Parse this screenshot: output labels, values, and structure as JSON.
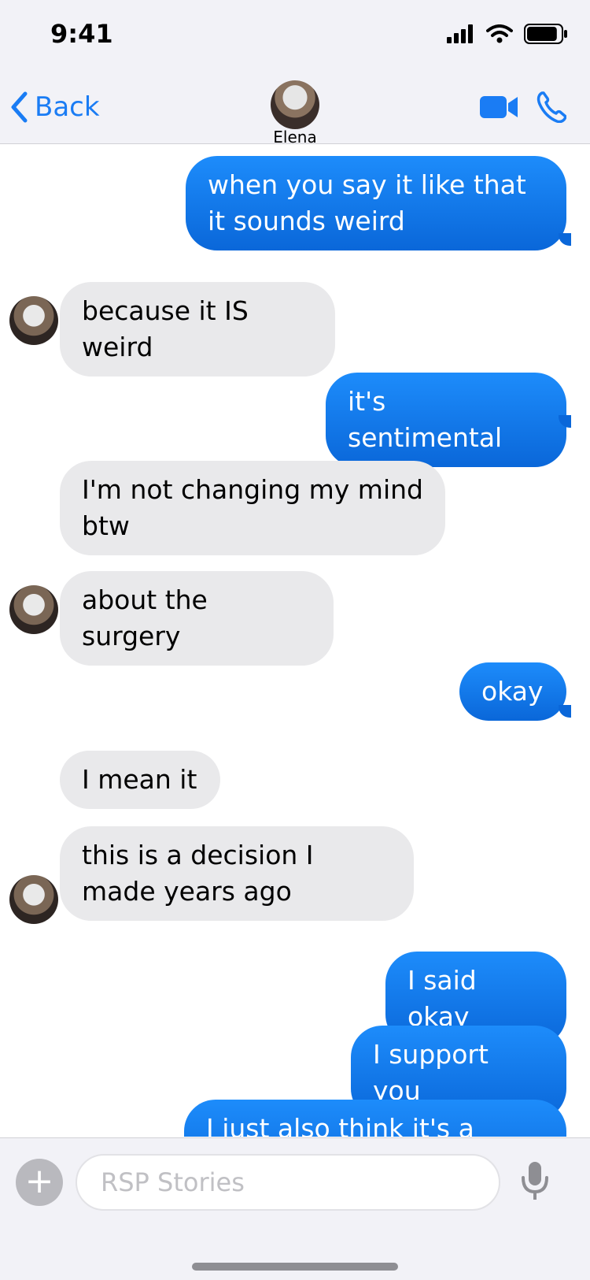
{
  "status_bar": {
    "time": "9:41",
    "battery_level": 0.9
  },
  "nav": {
    "back_label": "Back",
    "contact_name": "Elena"
  },
  "messages": [
    {
      "from": "me",
      "text": "when you say it like that it sounds weird"
    },
    {
      "from": "them",
      "text": "because it IS weird"
    },
    {
      "from": "me",
      "text": "it's sentimental"
    },
    {
      "from": "them",
      "text": "I'm not changing my mind btw"
    },
    {
      "from": "them",
      "text": "about the surgery"
    },
    {
      "from": "me",
      "text": "okay"
    },
    {
      "from": "them",
      "text": "I mean it"
    },
    {
      "from": "them",
      "text": "this is a decision I made years ago"
    },
    {
      "from": "me",
      "text": "I said okay"
    },
    {
      "from": "me",
      "text": "I support you"
    },
    {
      "from": "me",
      "text": "I just also think it's a waste"
    }
  ],
  "composer": {
    "placeholder": "RSP Stories"
  },
  "colors": {
    "accent": "#1a7cf4",
    "outgoing": "#0a7af0",
    "incoming": "#e9e9eb"
  },
  "icons": [
    "back-chevron-icon",
    "video-camera-icon",
    "phone-icon",
    "plus-icon",
    "microphone-icon"
  ]
}
